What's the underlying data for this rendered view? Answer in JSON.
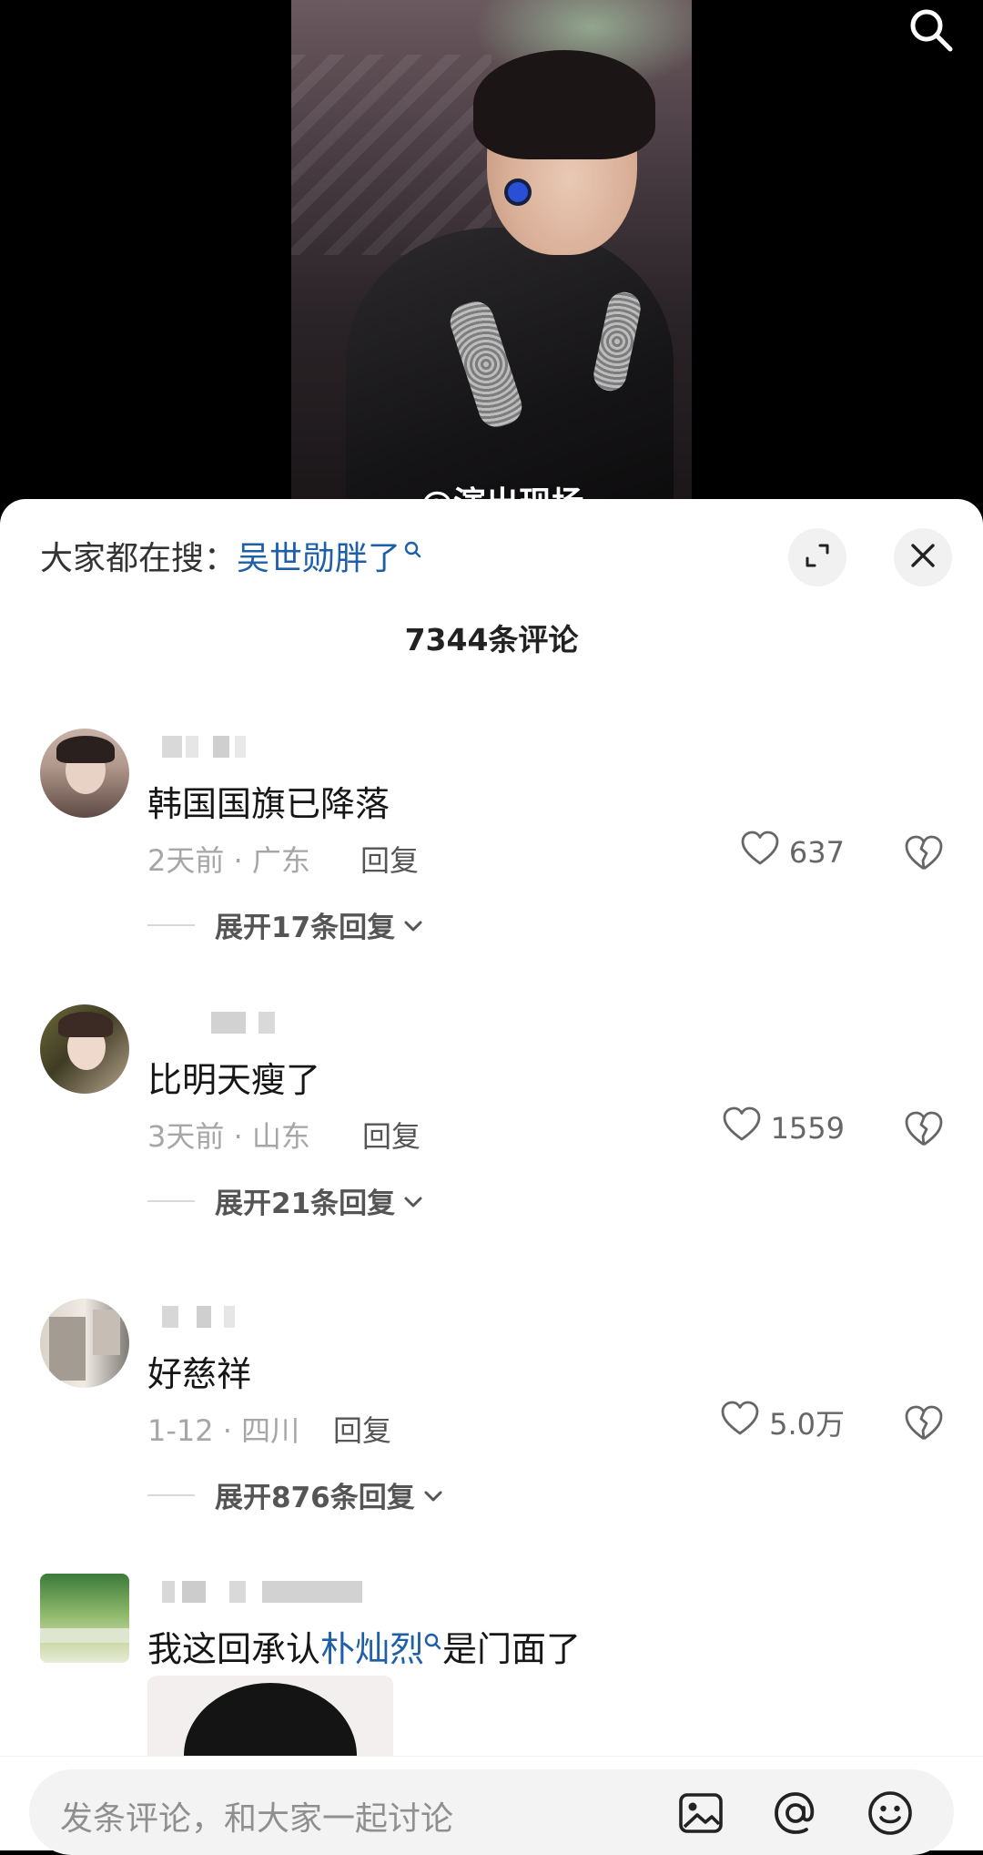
{
  "video": {
    "caption": "@演出现场"
  },
  "sheet": {
    "search_prefix": "大家都在搜：",
    "search_keyword": "吴世勋胖了",
    "comment_count_title": "7344条评论"
  },
  "comments": [
    {
      "text": "韩国国旗已降落",
      "time_location": "2天前 · 广东",
      "reply_label": "回复",
      "likes": "637",
      "expand_label": "展开17条回复"
    },
    {
      "text": "比明天瘦了",
      "time_location": "3天前 · 山东",
      "reply_label": "回复",
      "likes": "1559",
      "expand_label": "展开21条回复"
    },
    {
      "text": "好慈祥",
      "time_location": "1-12 · 四川",
      "reply_label": "回复",
      "likes": "5.0万",
      "expand_label": "展开876条回复"
    },
    {
      "text_before": "我这回承认",
      "text_link": "朴灿烈",
      "text_after": "是门面了"
    }
  ],
  "bottom_bar": {
    "placeholder": "发条评论，和大家一起讨论"
  },
  "colors": {
    "link": "#1f5fa8",
    "sheet_bg": "#ffffff",
    "muted_text": "#a6a6a6"
  },
  "icons": [
    "search-icon",
    "expand-icon",
    "close-icon",
    "heart-icon",
    "broken-heart-icon",
    "chevron-down-icon",
    "image-icon",
    "at-icon",
    "emoji-icon"
  ]
}
